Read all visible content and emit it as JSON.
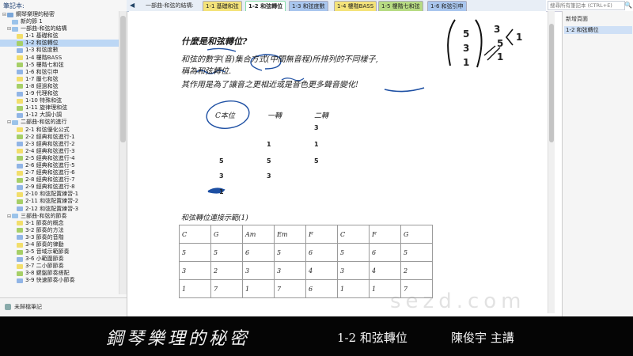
{
  "nav": {
    "title": "筆記本:",
    "bottom_label": "未歸檔筆記",
    "items": [
      {
        "label": "鋼琴樂理的秘密",
        "level": 0,
        "color": "#7aa6d8",
        "toggle": "⊟"
      },
      {
        "label": "新的節 1",
        "level": 1,
        "color": "#9bc3ea",
        "toggle": ""
      },
      {
        "label": "一部曲-和弦的結構",
        "level": 1,
        "color": "#9bc3ea",
        "toggle": "⊟"
      },
      {
        "label": "1-1 基礎和弦",
        "level": 2,
        "color": "#f2de6b",
        "toggle": ""
      },
      {
        "label": "1-2 和弦轉位",
        "level": 2,
        "color": "#a6cf67",
        "toggle": "",
        "selected": true
      },
      {
        "label": "1-3 和弦度數",
        "level": 2,
        "color": "#91b5e6",
        "toggle": ""
      },
      {
        "label": "1-4 樓階BASS",
        "level": 2,
        "color": "#f2de6b",
        "toggle": ""
      },
      {
        "label": "1-5 樓階七和弦",
        "level": 2,
        "color": "#a6cf67",
        "toggle": ""
      },
      {
        "label": "1-6 和弦引申",
        "level": 2,
        "color": "#91b5e6",
        "toggle": ""
      },
      {
        "label": "1-7 屬七和弦",
        "level": 2,
        "color": "#f2de6b",
        "toggle": ""
      },
      {
        "label": "1-8 經過和弦",
        "level": 2,
        "color": "#a6cf67",
        "toggle": ""
      },
      {
        "label": "1-9 代理和弦",
        "level": 2,
        "color": "#91b5e6",
        "toggle": ""
      },
      {
        "label": "1-10 特殊和弦",
        "level": 2,
        "color": "#f2de6b",
        "toggle": ""
      },
      {
        "label": "1-11 旋律理和弦",
        "level": 2,
        "color": "#a6cf67",
        "toggle": ""
      },
      {
        "label": "1-12 大調小調",
        "level": 2,
        "color": "#91b5e6",
        "toggle": ""
      },
      {
        "label": "二部曲-和弦的進行",
        "level": 1,
        "color": "#9bc3ea",
        "toggle": "⊟"
      },
      {
        "label": "2-1 和弦優化公式",
        "level": 2,
        "color": "#f2de6b",
        "toggle": ""
      },
      {
        "label": "2-2 經典和弦進行-1",
        "level": 2,
        "color": "#a6cf67",
        "toggle": ""
      },
      {
        "label": "2-3 經典和弦進行-2",
        "level": 2,
        "color": "#91b5e6",
        "toggle": ""
      },
      {
        "label": "2-4 經典和弦進行-3",
        "level": 2,
        "color": "#f2de6b",
        "toggle": ""
      },
      {
        "label": "2-5 經典和弦進行-4",
        "level": 2,
        "color": "#a6cf67",
        "toggle": ""
      },
      {
        "label": "2-6 經典和弦進行-5",
        "level": 2,
        "color": "#91b5e6",
        "toggle": ""
      },
      {
        "label": "2-7 經典和弦進行-6",
        "level": 2,
        "color": "#f2de6b",
        "toggle": ""
      },
      {
        "label": "2-8 經典和弦進行-7",
        "level": 2,
        "color": "#a6cf67",
        "toggle": ""
      },
      {
        "label": "2-9 經典和弦進行-8",
        "level": 2,
        "color": "#91b5e6",
        "toggle": ""
      },
      {
        "label": "2-10 和弦配置練習-1",
        "level": 2,
        "color": "#f2de6b",
        "toggle": ""
      },
      {
        "label": "2-11 和弦配置練習-2",
        "level": 2,
        "color": "#a6cf67",
        "toggle": ""
      },
      {
        "label": "2-12 和弦配置練習-3",
        "level": 2,
        "color": "#91b5e6",
        "toggle": ""
      },
      {
        "label": "三部曲-和弦的節奏",
        "level": 1,
        "color": "#9bc3ea",
        "toggle": "⊟"
      },
      {
        "label": "3-1 節奏的概念",
        "level": 2,
        "color": "#f2de6b",
        "toggle": ""
      },
      {
        "label": "3-2 節奏的方法",
        "level": 2,
        "color": "#a6cf67",
        "toggle": ""
      },
      {
        "label": "3-3 節奏的音階",
        "level": 2,
        "color": "#91b5e6",
        "toggle": ""
      },
      {
        "label": "3-4 節奏的律動",
        "level": 2,
        "color": "#f2de6b",
        "toggle": ""
      },
      {
        "label": "3-5 音域示範節奏",
        "level": 2,
        "color": "#a6cf67",
        "toggle": ""
      },
      {
        "label": "3-6 小範圍節奏",
        "level": 2,
        "color": "#91b5e6",
        "toggle": ""
      },
      {
        "label": "3-7 二小節節奏",
        "level": 2,
        "color": "#f2de6b",
        "toggle": ""
      },
      {
        "label": "3-8 鍵盤節奏搭配",
        "level": 2,
        "color": "#a6cf67",
        "toggle": ""
      },
      {
        "label": "3-9 快速節奏小節奏",
        "level": 2,
        "color": "#91b5e6",
        "toggle": ""
      }
    ]
  },
  "tabbar": {
    "back_icon": "◀",
    "notebook_label": "一部曲-和弦的結構:",
    "tabs": [
      {
        "label": "1-1 基礎和弦",
        "color": "#f4e37a",
        "active": false
      },
      {
        "label": "1-2 和弦轉位",
        "color": "#ffffff",
        "active": true
      },
      {
        "label": "1-3 和弦度數",
        "color": "#a9c6ee",
        "active": false
      },
      {
        "label": "1-4 樓階BASS",
        "color": "#f4e37a",
        "active": false
      },
      {
        "label": "1-5 樓階七和弦",
        "color": "#b7db83",
        "active": false
      },
      {
        "label": "1-6 和弦引申",
        "color": "#a9c6ee",
        "active": false
      }
    ]
  },
  "search": {
    "placeholder": "搜尋所有筆記本 (CTRL+E)",
    "icon": "🔍"
  },
  "rightpane": {
    "new_page": "新增頁面",
    "pages": [
      "1-2 和弦轉位"
    ]
  },
  "note": {
    "heading": "什麼是和弦轉位?",
    "line1": "和弦的數字(音)集合方式(中間無音程)所排列的不同樣子,",
    "line2": "稱為和弦轉位.",
    "line3": "其作用是為了讓音之更相近或是音色更多聲音變化!",
    "col_headers": [
      "C本位",
      "一轉",
      "二轉"
    ],
    "col0": [
      "5",
      "3",
      "1"
    ],
    "col1": [
      "1",
      "5",
      "3"
    ],
    "col2": [
      "3",
      "1",
      "5"
    ],
    "margin_left": [
      "5",
      "3",
      "1"
    ],
    "margin_right": [
      "3",
      "5",
      "1"
    ],
    "margin_extra": [
      "1"
    ],
    "table_caption": "和弦轉位連接示範(1)",
    "table": [
      [
        "C",
        "G",
        "Am",
        "Em",
        "F",
        "C",
        "F",
        "G"
      ],
      [
        "5",
        "5",
        "6",
        "5",
        "6",
        "5",
        "6",
        "5"
      ],
      [
        "3",
        "2",
        "3",
        "3",
        "4",
        "3",
        "4",
        "2"
      ],
      [
        "1",
        "7",
        "1",
        "7",
        "6",
        "1",
        "1",
        "7"
      ]
    ]
  },
  "watermark": "sezd.com",
  "caption": {
    "title": "鋼琴樂理的秘密",
    "lesson": "1-2 和弦轉位",
    "teacher": "陳俊宇 主講"
  }
}
